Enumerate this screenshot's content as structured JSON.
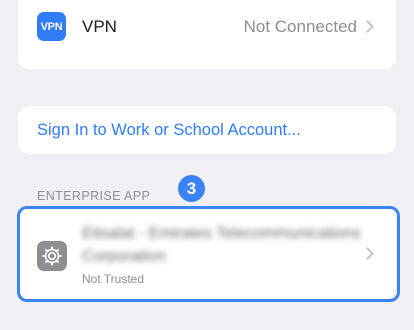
{
  "vpn": {
    "icon_text": "VPN",
    "label": "VPN",
    "status": "Not Connected",
    "icon": "vpn-icon"
  },
  "signin": {
    "label": "Sign In to Work or School Account..."
  },
  "enterprise": {
    "header": "ENTERPRISE APP",
    "step_badge": "3",
    "app_name": "Etisalat - Emirates Telecommunications Corporation",
    "app_status": "Not Trusted",
    "icon": "gear-icon"
  },
  "colors": {
    "accent": "#2f7cf6",
    "background": "#efeff4",
    "secondary_text": "#8e8e93",
    "highlight": "#3b84f5"
  }
}
